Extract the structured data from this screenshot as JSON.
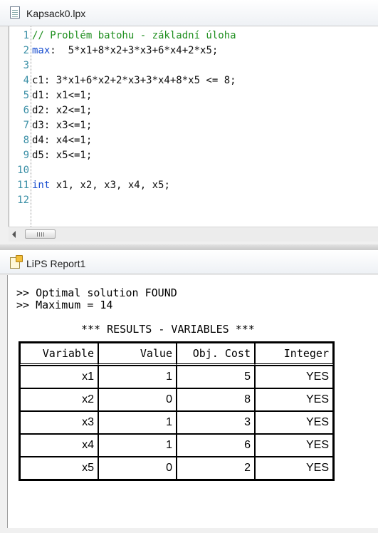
{
  "editor": {
    "title": "Kapsack0.lpx",
    "lines": [
      {
        "num": "1",
        "parts": [
          {
            "t": "// Problém batohu - základní úloha",
            "c": "comment"
          }
        ]
      },
      {
        "num": "2",
        "parts": [
          {
            "t": "max",
            "c": "kw"
          },
          {
            "t": ":  5*x1+8*x2+3*x3+6*x4+2*x5;",
            "c": ""
          }
        ]
      },
      {
        "num": "3",
        "parts": []
      },
      {
        "num": "4",
        "parts": [
          {
            "t": "c1: 3*x1+6*x2+2*x3+3*x4+8*x5 <= 8;",
            "c": ""
          }
        ]
      },
      {
        "num": "5",
        "parts": [
          {
            "t": "d1: x1<=1;",
            "c": ""
          }
        ]
      },
      {
        "num": "6",
        "parts": [
          {
            "t": "d2: x2<=1;",
            "c": ""
          }
        ]
      },
      {
        "num": "7",
        "parts": [
          {
            "t": "d3: x3<=1;",
            "c": ""
          }
        ]
      },
      {
        "num": "8",
        "parts": [
          {
            "t": "d4: x4<=1;",
            "c": ""
          }
        ]
      },
      {
        "num": "9",
        "parts": [
          {
            "t": "d5: x5<=1;",
            "c": ""
          }
        ]
      },
      {
        "num": "10",
        "parts": []
      },
      {
        "num": "11",
        "parts": [
          {
            "t": "int",
            "c": "kw"
          },
          {
            "t": " x1, x2, x3, x4, x5;",
            "c": ""
          }
        ]
      },
      {
        "num": "12",
        "parts": []
      }
    ]
  },
  "report": {
    "title": "LiPS Report1",
    "status_line": ">> Optimal solution FOUND",
    "max_line": ">> Maximum = 14",
    "section_title": "*** RESULTS - VARIABLES ***",
    "columns": [
      "Variable",
      "Value",
      "Obj. Cost",
      "Integer"
    ],
    "rows": [
      [
        "x1",
        "1",
        "5",
        "YES"
      ],
      [
        "x2",
        "0",
        "8",
        "YES"
      ],
      [
        "x3",
        "1",
        "3",
        "YES"
      ],
      [
        "x4",
        "1",
        "6",
        "YES"
      ],
      [
        "x5",
        "0",
        "2",
        "YES"
      ]
    ]
  },
  "colors": {
    "comment": "#1f8f1f",
    "keyword": "#1a4fd0",
    "line_number": "#3a8fa6"
  },
  "icons": {
    "editor_doc": "document-icon",
    "report_doc": "report-icon"
  }
}
